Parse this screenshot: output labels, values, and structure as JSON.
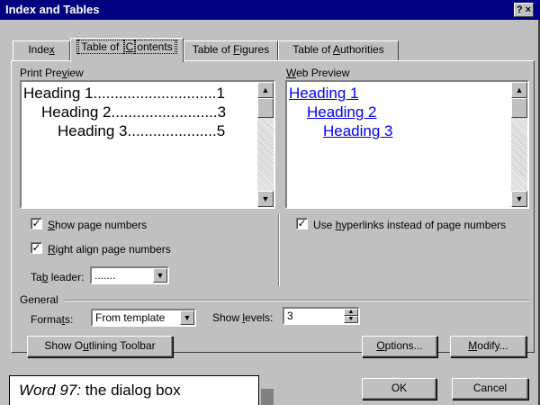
{
  "window": {
    "title": "Index and Tables",
    "help_label": "? ×"
  },
  "tabs": [
    {
      "label_pre": "Inde",
      "label_u": "x",
      "label_post": ""
    },
    {
      "label_pre": "Table of ",
      "label_u": "C",
      "label_post": "ontents"
    },
    {
      "label_pre": "Table of ",
      "label_u": "F",
      "label_post": "igures"
    },
    {
      "label_pre": "Table of ",
      "label_u": "A",
      "label_post": "uthorities"
    }
  ],
  "print_preview": {
    "label_pre": "Print Pre",
    "label_u": "v",
    "label_post": "iew",
    "lines": [
      {
        "text": "Heading 1",
        "leader": ".............................",
        "page": "1"
      },
      {
        "text": "Heading 2",
        "leader": ".........................",
        "page": "3"
      },
      {
        "text": "Heading 3",
        "leader": ".....................",
        "page": "5"
      }
    ]
  },
  "web_preview": {
    "label_pre": "",
    "label_u": "W",
    "label_post": "eb Preview",
    "lines": [
      "Heading 1",
      "Heading 2",
      "Heading 3"
    ]
  },
  "options": {
    "show_page_numbers": {
      "checked": true,
      "label_pre": "",
      "label_u": "S",
      "label_post": "how page numbers"
    },
    "right_align": {
      "checked": true,
      "label_pre": "",
      "label_u": "R",
      "label_post": "ight align page numbers"
    },
    "use_hyperlinks": {
      "checked": true,
      "label_pre": "Use ",
      "label_u": "h",
      "label_post": "yperlinks instead of page numbers"
    }
  },
  "tab_leader": {
    "label_pre": "Ta",
    "label_u": "b",
    "label_post": " leader:",
    "value": "......."
  },
  "general": {
    "title": "General",
    "formats": {
      "label_pre": "Forma",
      "label_u": "t",
      "label_post": "s:",
      "value": "From template"
    },
    "show_levels": {
      "label_pre": "Show ",
      "label_u": "l",
      "label_post": "evels:",
      "value": "3"
    }
  },
  "buttons": {
    "outlining": {
      "pre": "Show O",
      "u": "u",
      "post": "tlining Toolbar"
    },
    "options": {
      "pre": "",
      "u": "O",
      "post": "ptions..."
    },
    "modify": {
      "pre": "",
      "u": "M",
      "post": "odify..."
    },
    "ok": "OK",
    "cancel": "Cancel"
  },
  "caption": {
    "em": "Word 97:",
    "rest": " the dialog box"
  }
}
